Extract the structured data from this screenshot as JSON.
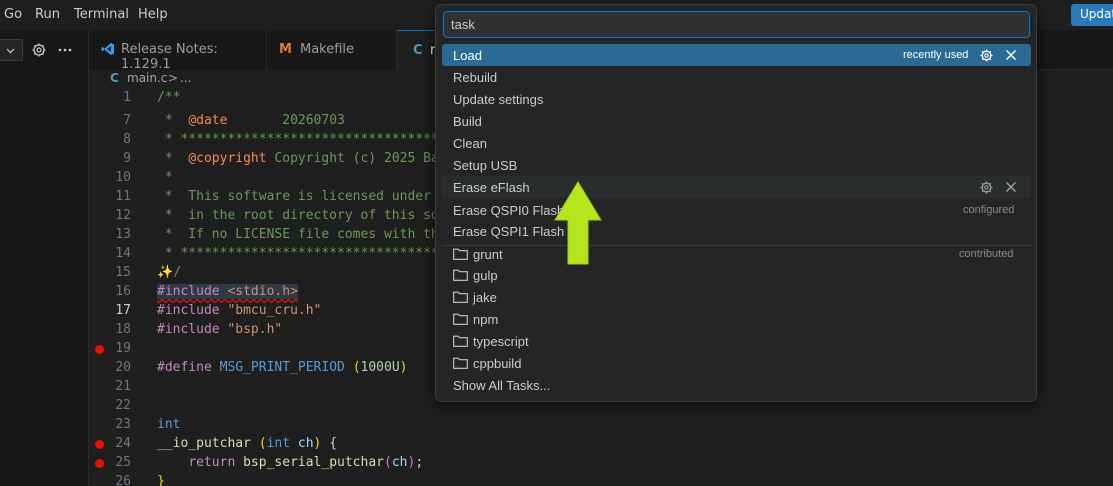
{
  "menubar": {
    "items": [
      "Go",
      "Run",
      "Terminal",
      "Help"
    ],
    "update_label": "Updat"
  },
  "tabs": [
    {
      "label": "Release Notes: 1.129.1",
      "icon": "vscode-icon"
    },
    {
      "label": "Makefile",
      "icon": "makefile-icon",
      "icon_glyph": "M"
    },
    {
      "label": "m",
      "icon": "c-file-icon",
      "icon_glyph": "C"
    }
  ],
  "breadcrumb": {
    "icon_glyph": "C",
    "file": "main.c",
    "separator": ">",
    "more": "..."
  },
  "editor": {
    "lines": [
      {
        "num": "1",
        "text": "/**"
      },
      {
        "num": "7",
        "text": " *  @date       20260703"
      },
      {
        "num": "8",
        "text": " * ************************************"
      },
      {
        "num": "9",
        "text": " *  @copyright Copyright (c) 2025 Ba"
      },
      {
        "num": "10",
        "text": " *"
      },
      {
        "num": "11",
        "text": " *  This software is licensed under"
      },
      {
        "num": "12",
        "text": " *  in the root directory of this so"
      },
      {
        "num": "13",
        "text": " *  If no LICENSE file comes with th"
      },
      {
        "num": "14",
        "text": " * ************************************"
      },
      {
        "num": "15",
        "text": "*/"
      },
      {
        "num": "16",
        "text": "#include <stdio.h>"
      },
      {
        "num": "17",
        "text": "#include \"bmcu_cru.h\""
      },
      {
        "num": "18",
        "text": "#include \"bsp.h\""
      },
      {
        "num": "19",
        "text": ""
      },
      {
        "num": "20",
        "text": "#define MSG_PRINT_PERIOD (1000U)"
      },
      {
        "num": "21",
        "text": ""
      },
      {
        "num": "22",
        "text": ""
      },
      {
        "num": "23",
        "text": "int"
      },
      {
        "num": "24",
        "text": "__io_putchar (int ch) {"
      },
      {
        "num": "25",
        "text": "    return bsp_serial_putchar(ch);"
      },
      {
        "num": "26",
        "text": "}"
      }
    ],
    "code": {
      "l7_star": " *  ",
      "l7_tag": "@date",
      "l7_val": "       20260703",
      "l8": " * ************************************",
      "l9_star": " *  ",
      "l9_tag": "@copyright",
      "l9_val": " Copyright (c) 2025 Ba",
      "l10": " *",
      "l11": " *  This software is licensed under",
      "l12": " *  in the root directory of this so",
      "l13": " *  If no LICENSE file comes with th",
      "l14": " * ************************************",
      "l15_sparkle": "✨",
      "l15_rest": "/",
      "l16_pp": "#include",
      "l16_sp": " ",
      "l16_hdr": "<stdio.h>",
      "l17_pp": "#include",
      "l17_str": " \"bmcu_cru.h\"",
      "l18_pp": "#include",
      "l18_str": " \"bsp.h\"",
      "l20_pp": "#define",
      "l20_mac": " MSG_PRINT_PERIOD ",
      "l20_p1": "(",
      "l20_num": "1000U",
      "l20_p2": ")",
      "l23_kw": "int",
      "l24_fn": "__io_putchar",
      "l24_sp": " ",
      "l24_p1": "(",
      "l24_kw": "int",
      "l24_arg": " ch",
      "l24_p2": ")",
      "l24_br": " {",
      "l25_ind": "    ",
      "l25_kw": "return",
      "l25_fn": " bsp_serial_putchar",
      "l25_p1": "(",
      "l25_arg": "ch",
      "l25_p2": ")",
      "l25_semi": ";",
      "l26": "}"
    },
    "breakpoint_lines": [
      "19",
      "24",
      "25"
    ]
  },
  "quick_pick": {
    "input_value": "task",
    "items": [
      {
        "label": "Load",
        "description": "recently used",
        "selected": true
      },
      {
        "label": "Rebuild"
      },
      {
        "label": "Update settings"
      },
      {
        "label": "Build"
      },
      {
        "label": "Clean"
      },
      {
        "label": "Setup USB"
      },
      {
        "label": "Erase eFlash",
        "hover": true
      },
      {
        "label": "Erase QSPI0 Flash",
        "description": "configured"
      },
      {
        "label": "Erase QSPI1 Flash"
      },
      {
        "label": "grunt",
        "description": "contributed",
        "folder": true
      },
      {
        "label": "gulp",
        "folder": true
      },
      {
        "label": "jake",
        "folder": true
      },
      {
        "label": "npm",
        "folder": true
      },
      {
        "label": "typescript",
        "folder": true
      },
      {
        "label": "cppbuild",
        "folder": true
      },
      {
        "label": "Show All Tasks..."
      }
    ]
  },
  "colors": {
    "accent": "#0078d4",
    "selection": "#2a6a94",
    "arrow": "#b5e61d",
    "breakpoint": "#e51400"
  }
}
